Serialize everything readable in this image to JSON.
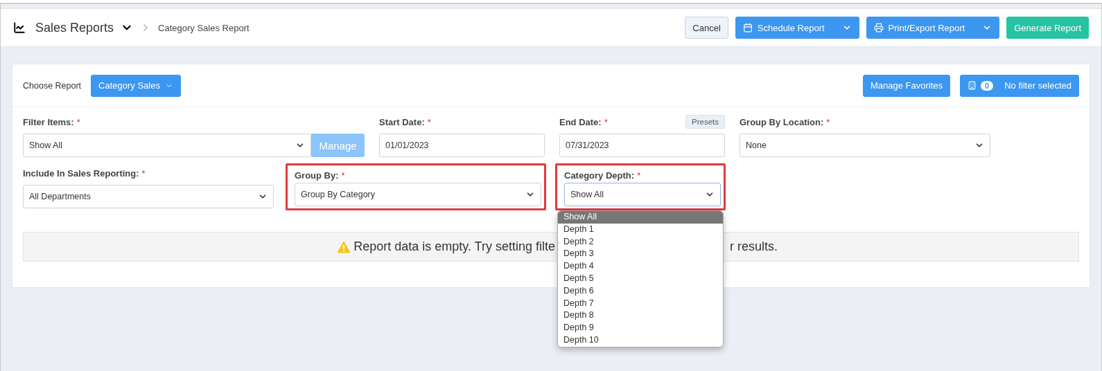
{
  "header": {
    "title": "Sales Reports",
    "breadcrumb": "Category Sales Report",
    "buttons": [
      {
        "label": "Cancel",
        "kind": "outline"
      },
      {
        "label": "Schedule Report",
        "kind": "split"
      },
      {
        "label": "Print/Export Report",
        "kind": "split"
      },
      {
        "label": "Generate Report",
        "kind": "success"
      }
    ]
  },
  "toolbar": {
    "choose_label": "Choose Report",
    "report_button": "Category Sales",
    "favorites_button": "Manage Favorites",
    "filter_count": "0",
    "filter_label": "No filter selected"
  },
  "row_1": [
    {
      "label": "Filter Items:",
      "required_mark": "*",
      "kind": "select",
      "value": "Show All",
      "action": {
        "label": "Manage",
        "disabled": true
      }
    },
    {
      "label": "Start Date:",
      "required_mark": "*",
      "kind": "date",
      "value": "01/01/2023"
    },
    {
      "label": "End Date:",
      "required_mark": "*",
      "kind": "date",
      "value": "07/31/2023",
      "presets": "Presets"
    },
    {
      "label": "Group By Location:",
      "required_mark": "*",
      "kind": "select",
      "value": "None"
    }
  ],
  "row_2": [
    {
      "label": "Include In Sales Reporting:",
      "required_mark": "*",
      "kind": "select",
      "value": "All Departments"
    },
    {
      "label": "Group By:",
      "required_mark": "*",
      "kind": "select",
      "value": "Group By Category",
      "highlighted": true
    },
    {
      "label": "Category Depth:",
      "required_mark": "*",
      "kind": "select",
      "value": "Show All",
      "highlighted": true,
      "expanded": true,
      "options": [
        {
          "label": "Show All",
          "selected": true
        },
        {
          "label": "Depth 1",
          "selected": false
        },
        {
          "label": "Depth 2",
          "selected": false
        },
        {
          "label": "Depth 3",
          "selected": false
        },
        {
          "label": "Depth 4",
          "selected": false
        },
        {
          "label": "Depth 5",
          "selected": false
        },
        {
          "label": "Depth 6",
          "selected": false
        },
        {
          "label": "Depth 7",
          "selected": false
        },
        {
          "label": "Depth 8",
          "selected": false
        },
        {
          "label": "Depth 9",
          "selected": false
        },
        {
          "label": "Depth 10",
          "selected": false
        }
      ]
    }
  ],
  "empty_message": {
    "before": "Report data is empty. Try setting filte",
    "after": "r results."
  }
}
